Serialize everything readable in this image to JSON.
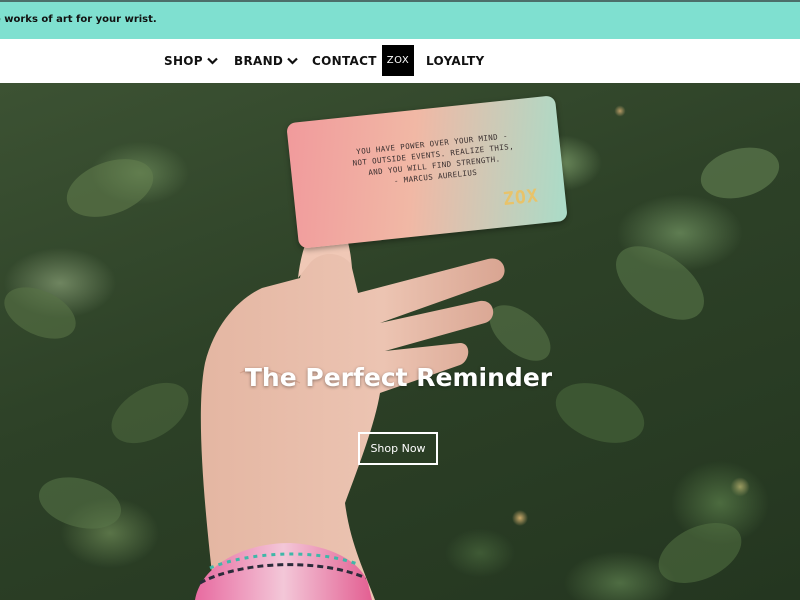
{
  "announcement": {
    "text": "e works of art for your wrist."
  },
  "nav": {
    "items": [
      {
        "label": "SHOP",
        "has_dropdown": true,
        "icon": "chevron-down-icon"
      },
      {
        "label": "BRAND",
        "has_dropdown": true,
        "icon": "chevron-down-icon"
      },
      {
        "label": "CONTACT",
        "has_dropdown": false
      },
      {
        "label": "LOYALTY",
        "has_dropdown": false
      }
    ],
    "logo": "ZOX"
  },
  "hero": {
    "card_quote": [
      "YOU HAVE POWER OVER YOUR MIND -",
      "NOT OUTSIDE EVENTS. REALIZE THIS,",
      "AND YOU WILL FIND STRENGTH.",
      "- MARCUS AURELIUS"
    ],
    "card_brand": "ZOX",
    "title": "The Perfect Reminder",
    "cta_label": "Shop Now"
  },
  "colors": {
    "announcement_bg": "#7fe0d0",
    "nav_logo_bg": "#000000",
    "hero_text": "#ffffff"
  }
}
